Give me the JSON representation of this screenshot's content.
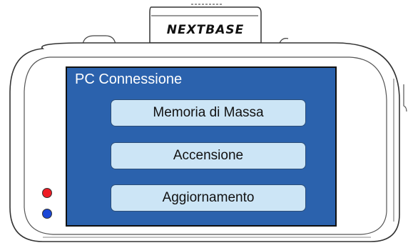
{
  "device": {
    "brand": "NEXTBASE"
  },
  "screen": {
    "title": "PC Connessione",
    "menu": [
      {
        "label": "Memoria di Massa"
      },
      {
        "label": "Accensione"
      },
      {
        "label": "Aggiornamento"
      }
    ]
  },
  "leds": {
    "red_color": "#ee1c25",
    "blue_color": "#1a47d6"
  },
  "colors": {
    "screen_bg": "#2b62ad",
    "button_bg": "#cce5f6",
    "title_text": "#ffffff"
  }
}
